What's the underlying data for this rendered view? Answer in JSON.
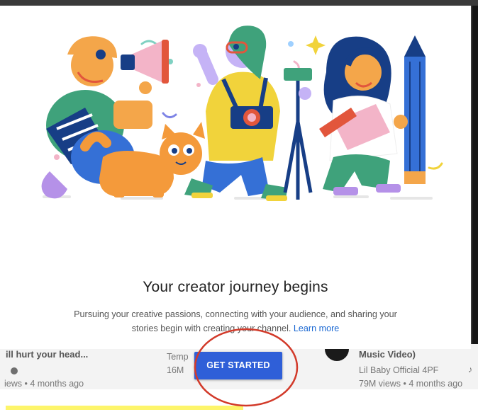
{
  "dialog": {
    "title": "Your creator journey begins",
    "body_line1": "Pursuing your creative passions, connecting with your audience, and sharing your",
    "body_line2": "stories begin with creating your channel.",
    "learn_more": "Learn more",
    "cta_label": "GET STARTED"
  },
  "background": {
    "left_title": "ill hurt your head...",
    "left_meta": "iews • 4 months ago",
    "mid_title": "Temp",
    "mid_meta": "16M",
    "right_title": "Music Video)",
    "right_channel": "Lil Baby Official 4PF",
    "right_meta": "79M views • 4 months ago"
  },
  "colors": {
    "cta": "#2f5fd8",
    "link": "#1967d2",
    "annotation_circle": "#d23a2a",
    "highlight_bar": "#fdf56a"
  },
  "icons": [
    "music-note-icon",
    "verified-icon",
    "megaphone-icon",
    "camera-icon",
    "pencil-icon",
    "sparkle-icon"
  ]
}
